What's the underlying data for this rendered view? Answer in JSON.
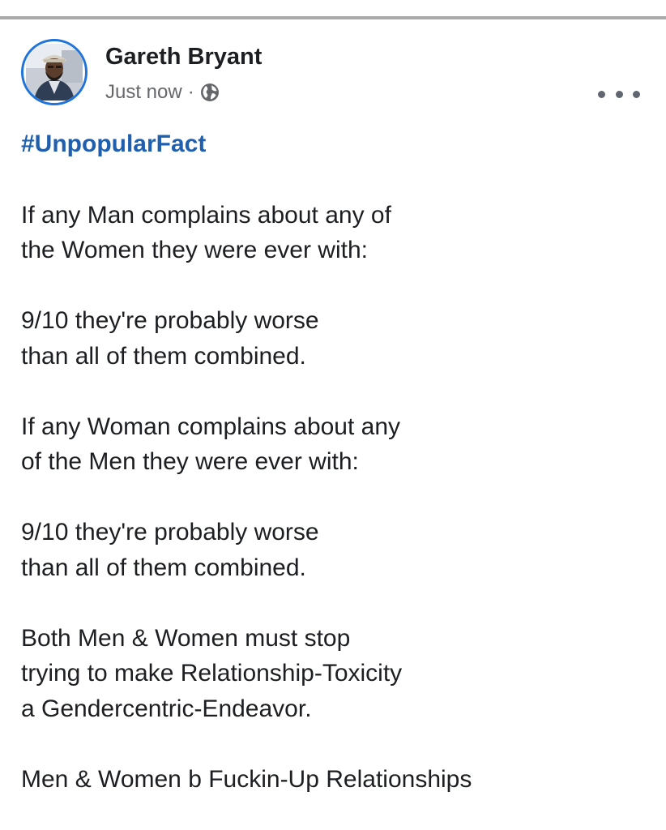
{
  "post": {
    "author": "Gareth Bryant",
    "timestamp": "Just now",
    "separator": "·",
    "privacy_icon": "globe-icon",
    "avatar_border_color": "#1f73d9",
    "hashtag_color": "#1f5fad",
    "hashtag": "#UnpopularFact",
    "paragraphs": [
      {
        "lines": [
          "If any Man complains about any of",
          "the Women they were ever with:"
        ]
      },
      {
        "lines": [
          "9/10 they're probably worse",
          "than all of them combined."
        ]
      },
      {
        "lines": [
          "If any Woman complains about any",
          "of the Men they were ever with:"
        ]
      },
      {
        "lines": [
          "9/10 they're probably worse",
          "than all of them combined."
        ]
      },
      {
        "lines": [
          "Both Men & Women must stop",
          "trying to make Relationship-Toxicity",
          "a Gendercentric-Endeavor."
        ]
      },
      {
        "lines": [
          "Men & Women b Fuckin-Up Relationships"
        ]
      }
    ],
    "more_icon": "more-options-icon"
  }
}
